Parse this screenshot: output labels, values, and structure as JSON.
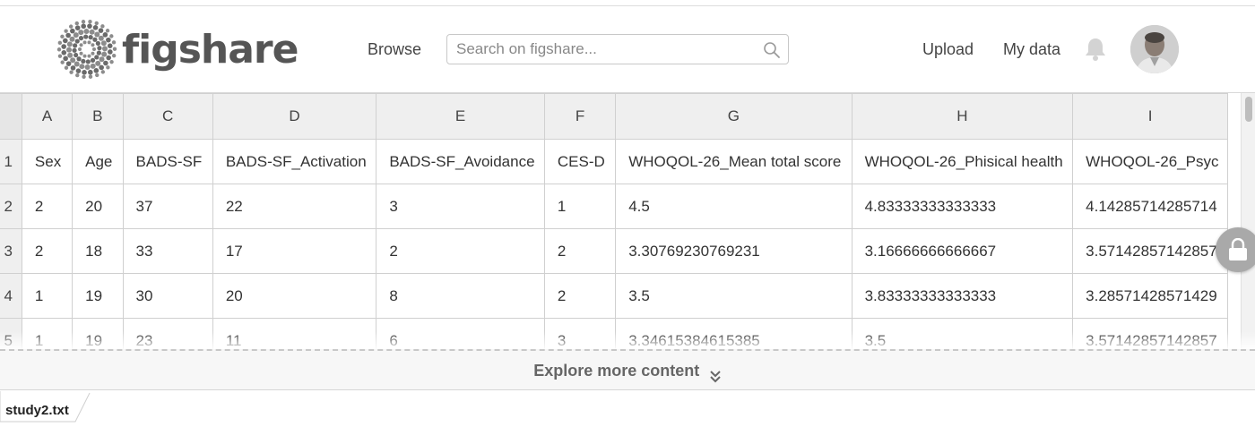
{
  "header": {
    "logo_text": "figshare",
    "nav_browse": "Browse",
    "search_placeholder": "Search on figshare...",
    "nav_upload": "Upload",
    "nav_mydata": "My data",
    "icons": {
      "search": "search-icon",
      "bell": "bell-icon",
      "avatar": "user-avatar"
    }
  },
  "sheet": {
    "columns": [
      "A",
      "B",
      "C",
      "D",
      "E",
      "F",
      "G",
      "H",
      "I"
    ],
    "rows": [
      {
        "num": "1",
        "cells": [
          "Sex",
          "Age",
          "BADS-SF",
          "BADS-SF_Activation",
          "BADS-SF_Avoidance",
          "CES-D",
          "WHOQOL-26_Mean total score",
          "WHOQOL-26_Phisical health",
          "WHOQOL-26_Psyc"
        ]
      },
      {
        "num": "2",
        "cells": [
          "2",
          "20",
          "37",
          "22",
          "3",
          "1",
          "4.5",
          "4.83333333333333",
          "4.14285714285714"
        ]
      },
      {
        "num": "3",
        "cells": [
          "2",
          "18",
          "33",
          "17",
          "2",
          "2",
          "3.30769230769231",
          "3.16666666666667",
          "3.57142857142857"
        ]
      },
      {
        "num": "4",
        "cells": [
          "1",
          "19",
          "30",
          "20",
          "8",
          "2",
          "3.5",
          "3.83333333333333",
          "3.28571428571429"
        ]
      },
      {
        "num": "5",
        "cells": [
          "1",
          "19",
          "23",
          "11",
          "6",
          "3",
          "3.34615384615385",
          "3.5",
          "3.57142857142857"
        ]
      }
    ]
  },
  "explore_label": "Explore more content",
  "file_tab": "study2.txt",
  "colors": {
    "logo_gray": "#555555",
    "header_cell_bg": "#efefef",
    "grid_line": "#d0d0d0",
    "lock_button": "#a9a9a9"
  }
}
